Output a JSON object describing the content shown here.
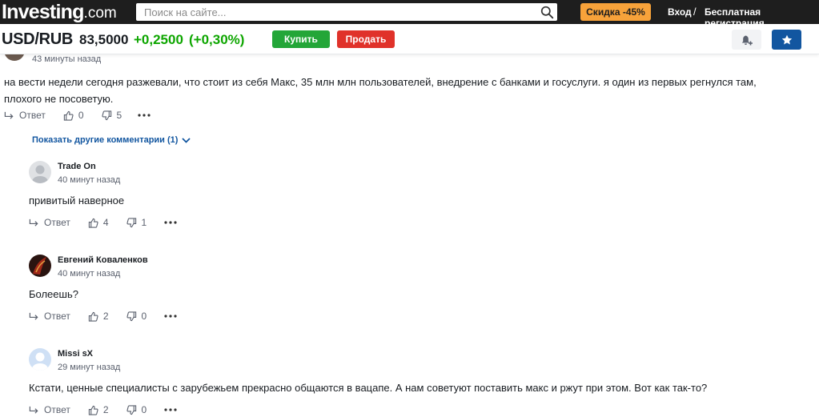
{
  "header": {
    "logo_main": "Investing",
    "logo_tld": ".com",
    "search_placeholder": "Поиск на сайте...",
    "promo": "Скидка -45%",
    "login": "Вход",
    "separator": "/",
    "register": "Бесплатная регистрация"
  },
  "instrument": {
    "symbol": "USD/RUB",
    "price": "83,5000",
    "change": "+0,2500",
    "change_pct": "(+0,30%)",
    "buy": "Купить",
    "sell": "Продать"
  },
  "colors": {
    "topbar": "#1e1e1e",
    "promo": "#f7a23a",
    "positive": "#0ea600",
    "buy": "#23a638",
    "sell": "#e0322a",
    "link": "#1256a0"
  },
  "top_comment": {
    "time": "43 минуты назад",
    "text": "на вести недели сегодня разжевали, что стоит из себя Макс, 35 млн млн пользователей, внедрение с банками и госуслуги. я один из первых регнулся там, плохого не посоветую.",
    "reply_label": "Ответ",
    "likes": "0",
    "dislikes": "5",
    "show_more": "Показать другие комментарии (1)"
  },
  "replies": [
    {
      "author": "Trade On",
      "time": "40 минут назад",
      "text": "привитый наверное",
      "reply_label": "Ответ",
      "likes": "4",
      "dislikes": "1"
    },
    {
      "author": "Евгений Коваленков",
      "time": "40 минут назад",
      "text": "Болеешь?",
      "reply_label": "Ответ",
      "likes": "2",
      "dislikes": "0"
    },
    {
      "author": "Missi sX",
      "time": "29 минут назад",
      "text": "Кстати, ценные специалисты с зарубежьем прекрасно общаются в вацапе. А нам советуют поставить макс и ржут при этом. Вот как так-то?",
      "reply_label": "Ответ",
      "likes": "2",
      "dislikes": "0"
    }
  ]
}
